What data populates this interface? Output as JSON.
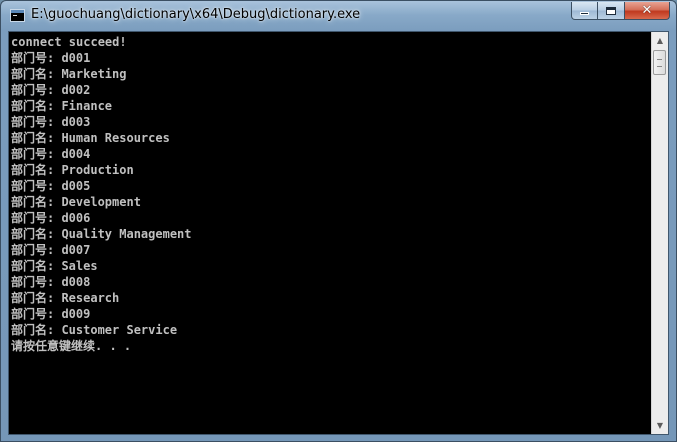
{
  "window": {
    "title": "E:\\guochuang\\dictionary\\x64\\Debug\\dictionary.exe",
    "controls": {
      "minimize": "minimize",
      "maximize": "maximize",
      "close": "close"
    }
  },
  "console": {
    "lines": [
      "connect succeed!",
      "部门号: d001",
      "部门名: Marketing",
      "部门号: d002",
      "部门名: Finance",
      "部门号: d003",
      "部门名: Human Resources",
      "部门号: d004",
      "部门名: Production",
      "部门号: d005",
      "部门名: Development",
      "部门号: d006",
      "部门名: Quality Management",
      "部门号: d007",
      "部门名: Sales",
      "部门号: d008",
      "部门名: Research",
      "部门号: d009",
      "部门名: Customer Service",
      "请按任意键继续. . ."
    ],
    "colors": {
      "background": "#000000",
      "text": "#c0c0c0"
    }
  },
  "icons": {
    "app": "console-app-icon",
    "scroll_up": "arrow-up-icon",
    "scroll_down": "arrow-down-icon"
  }
}
